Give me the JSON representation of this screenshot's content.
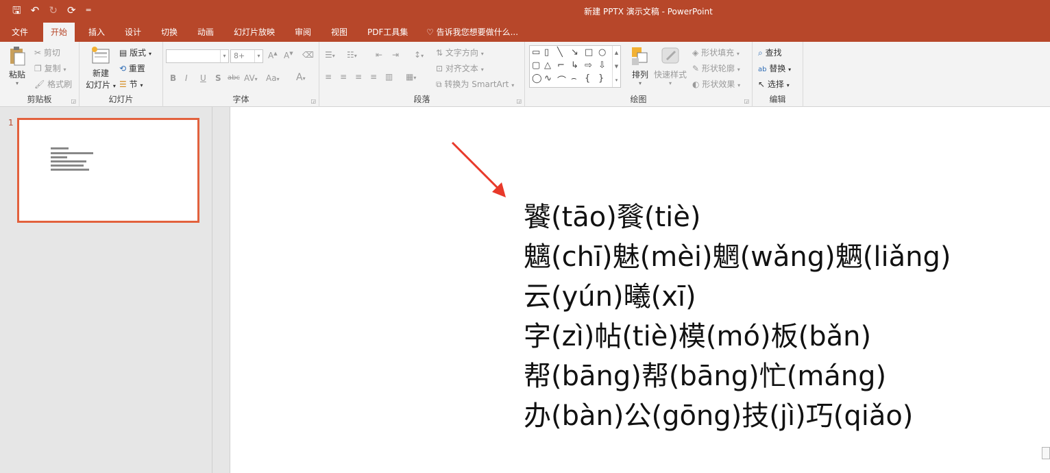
{
  "window": {
    "title": "新建 PPTX 演示文稿 - PowerPoint"
  },
  "qat": {
    "save": "🖫",
    "undo": "↶",
    "redo": "↻",
    "present": "⟳",
    "customize": "="
  },
  "tabs": [
    {
      "label": "文件"
    },
    {
      "label": "开始"
    },
    {
      "label": "插入"
    },
    {
      "label": "设计"
    },
    {
      "label": "切换"
    },
    {
      "label": "动画"
    },
    {
      "label": "幻灯片放映"
    },
    {
      "label": "审阅"
    },
    {
      "label": "视图"
    },
    {
      "label": "PDF工具集"
    }
  ],
  "tellme": "告诉我您想要做什么...",
  "ribbon": {
    "clipboard": {
      "label": "剪贴板",
      "paste": "粘贴",
      "cut": "剪切",
      "copy": "复制",
      "format_painter": "格式刷"
    },
    "slides": {
      "label": "幻灯片",
      "new_slide_1": "新建",
      "new_slide_2": "幻灯片",
      "layout": "版式",
      "reset": "重置",
      "section": "节"
    },
    "font": {
      "label": "字体",
      "size": "8+",
      "bold": "B",
      "italic": "I",
      "underline": "U",
      "shadow": "S",
      "strike": "abc",
      "spacing": "AV",
      "case": "Aa",
      "color": "A"
    },
    "paragraph": {
      "label": "段落",
      "direction": "文字方向",
      "align": "对齐文本",
      "smartart": "转换为 SmartArt"
    },
    "drawing": {
      "label": "绘图",
      "arrange": "排列",
      "quick_styles": "快速样式",
      "fill": "形状填充",
      "outline": "形状轮廓",
      "effects": "形状效果"
    },
    "editing": {
      "label": "编辑",
      "find": "查找",
      "replace": "替换",
      "select": "选择"
    }
  },
  "thumbnails": [
    {
      "number": "1"
    }
  ],
  "slide": {
    "lines": [
      "饕(tāo)餮(tiè)",
      "魑(chī)魅(mèi)魍(wǎng)魉(liǎng)",
      "云(yún)曦(xī)",
      "字(zì)帖(tiè)模(mó)板(bǎn)",
      "帮(bāng)帮(bāng)忙(máng)",
      "办(bàn)公(gōng)技(jì)巧(qiǎo)"
    ]
  },
  "colors": {
    "brand": "#b7472a",
    "thumb_border": "#e2613d",
    "annotation_arrow": "#e8392a"
  }
}
